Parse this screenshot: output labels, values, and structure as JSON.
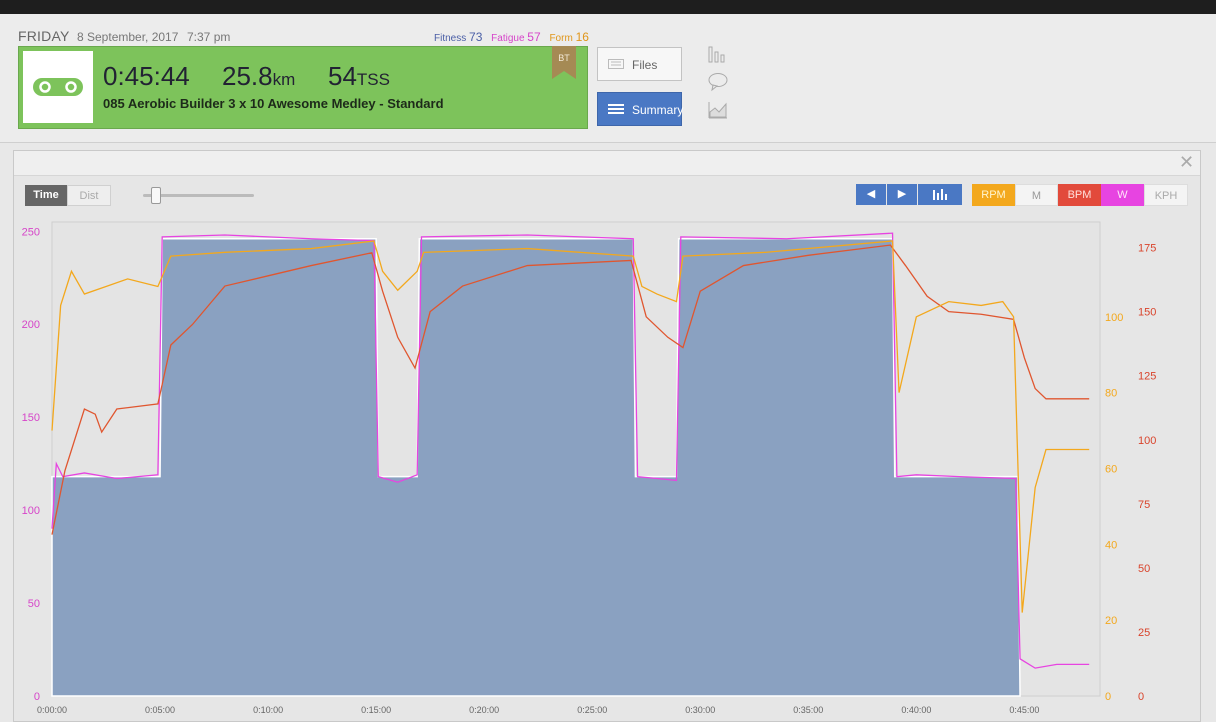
{
  "header": {
    "day": "FRIDAY",
    "date": "8 September, 2017",
    "time": "7:37 pm",
    "fitness_label": "Fitness",
    "fitness_value": "73",
    "fatigue_label": "Fatigue",
    "fatigue_value": "57",
    "form_label": "Form",
    "form_value": "16"
  },
  "workout": {
    "icon": "bike-chain-icon",
    "duration": "0:45:44",
    "distance": "25.8",
    "distance_unit": "km",
    "tss": "54",
    "tss_unit": "TSS",
    "name": "085 Aerobic Builder 3 x 10 Awesome Medley - Standard",
    "badge": "BT",
    "card_color": "#7dc35b"
  },
  "buttons": {
    "files": "Files",
    "summary": "Summary"
  },
  "side_icons": [
    "bar-chart-icon",
    "comment-icon",
    "area-chart-icon"
  ],
  "chart_controls": {
    "time_label": "Time",
    "dist_label": "Dist",
    "series_toggles": [
      "RPM",
      "M",
      "BPM",
      "W",
      "KPH"
    ]
  },
  "chart_data": {
    "type": "area",
    "x_unit": "minutes",
    "x_ticks": [
      "0:00:00",
      "0:05:00",
      "0:10:00",
      "0:15:00",
      "0:20:00",
      "0:25:00",
      "0:30:00",
      "0:35:00",
      "0:40:00",
      "0:45:00"
    ],
    "xlim": [
      0,
      48.5
    ],
    "y_left": {
      "ticks": [
        "0",
        "50",
        "100",
        "150",
        "200",
        "250"
      ],
      "range": [
        0,
        255
      ],
      "color": "#d645c9"
    },
    "y_right_cadence": {
      "ticks": [
        "0",
        "20",
        "40",
        "60",
        "80",
        "100"
      ],
      "range": [
        0,
        125
      ],
      "color": "#f3a81d"
    },
    "y_right_hr": {
      "ticks": [
        "0",
        "25",
        "50",
        "75",
        "100",
        "125",
        "150",
        "175"
      ],
      "range": [
        0,
        185
      ],
      "color": "#d9442c"
    },
    "series": [
      {
        "name": "W",
        "kind": "target",
        "color": "#8aa1c1",
        "x": [
          0.0,
          5.0,
          5.1,
          15.0,
          15.1,
          16.9,
          17.0,
          26.9,
          27.0,
          28.9,
          29.0,
          38.9,
          39.0,
          44.7,
          44.8
        ],
        "y": [
          118,
          118,
          246,
          246,
          118,
          118,
          246,
          246,
          118,
          118,
          246,
          246,
          118,
          118,
          0
        ]
      },
      {
        "name": "W",
        "kind": "actual",
        "color": "#e744e1",
        "x": [
          0.0,
          0.2,
          0.5,
          1.5,
          3.0,
          4.9,
          5.1,
          8.0,
          12.0,
          14.9,
          15.1,
          16.0,
          16.9,
          17.1,
          22.0,
          26.9,
          27.1,
          28.0,
          28.9,
          29.1,
          34.0,
          38.9,
          39.1,
          40.0,
          42.0,
          44.6,
          44.8,
          45.5,
          46.5,
          48.0
        ],
        "y": [
          90,
          125,
          118,
          120,
          117,
          119,
          247,
          248,
          246,
          245,
          118,
          115,
          119,
          247,
          248,
          246,
          118,
          117,
          116,
          247,
          246,
          249,
          118,
          119,
          118,
          117,
          20,
          15,
          17,
          17
        ]
      },
      {
        "name": "BPM",
        "color": "#e0562f",
        "x": [
          0.0,
          0.6,
          1.5,
          2.0,
          2.3,
          3.0,
          4.9,
          5.5,
          6.5,
          8.0,
          10.0,
          12.0,
          14.8,
          15.3,
          16.0,
          16.8,
          17.5,
          19.0,
          22.0,
          26.8,
          27.5,
          28.5,
          29.2,
          30.0,
          32.0,
          35.0,
          38.8,
          39.5,
          40.5,
          41.5,
          43.0,
          44.5,
          45.0,
          45.5,
          46.0,
          48.0
        ],
        "y": [
          63,
          88,
          112,
          110,
          103,
          112,
          114,
          137,
          145,
          160,
          164,
          168,
          173,
          158,
          140,
          128,
          150,
          160,
          168,
          170,
          148,
          140,
          136,
          158,
          168,
          172,
          176,
          168,
          156,
          150,
          149,
          147,
          132,
          120,
          116,
          116
        ]
      },
      {
        "name": "RPM",
        "color": "#f3a81d",
        "x": [
          0.0,
          0.4,
          0.9,
          1.5,
          2.5,
          3.5,
          4.9,
          5.5,
          8.0,
          12.0,
          14.9,
          15.3,
          16.0,
          16.9,
          17.2,
          22.0,
          26.9,
          27.3,
          28.0,
          28.9,
          29.2,
          33.0,
          38.9,
          39.2,
          40.0,
          41.5,
          43.0,
          44.0,
          44.5,
          44.9,
          45.5,
          46.0,
          48.0
        ],
        "y": [
          70,
          103,
          112,
          106,
          108,
          110,
          108,
          116,
          117,
          118,
          120,
          112,
          107,
          112,
          117,
          118,
          116,
          108,
          106,
          104,
          116,
          117,
          120,
          80,
          100,
          104,
          103,
          104,
          100,
          22,
          55,
          65,
          65
        ]
      }
    ]
  }
}
